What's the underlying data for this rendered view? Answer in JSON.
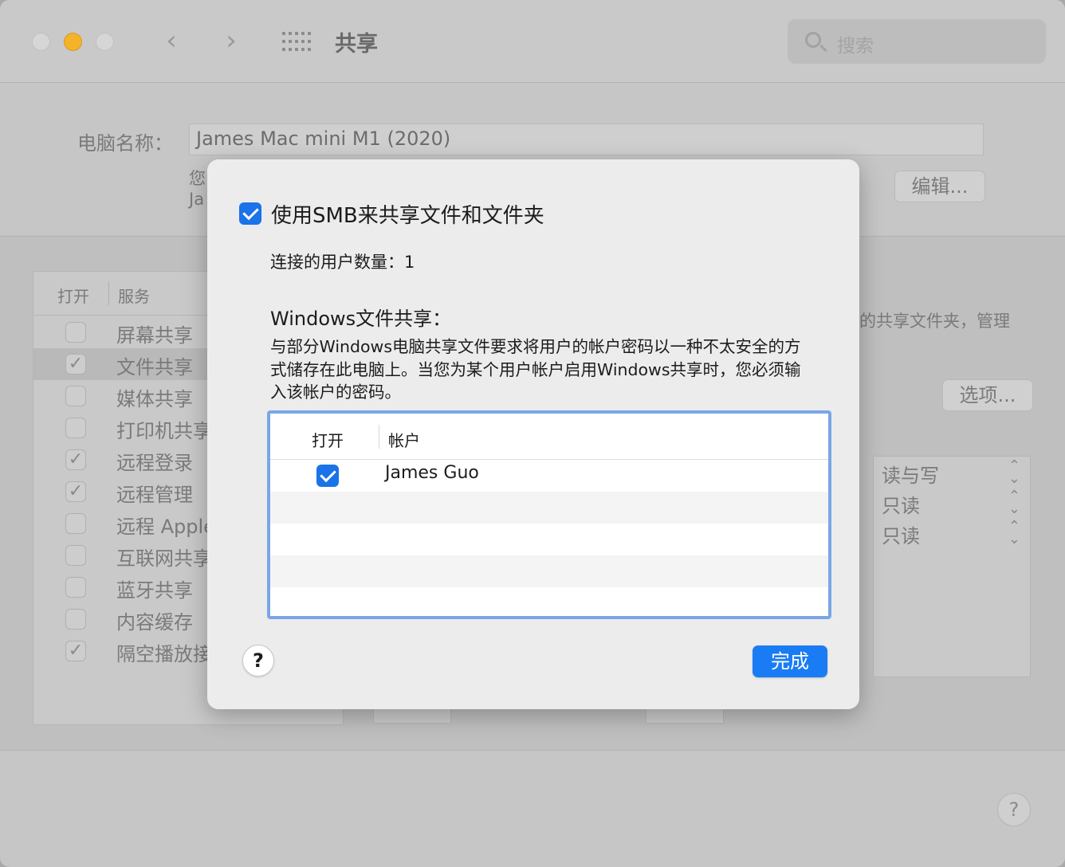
{
  "window": {
    "title": "共享"
  },
  "search": {
    "placeholder": "搜索"
  },
  "computer_name": {
    "label": "电脑名称：",
    "value": "James Mac mini M1 (2020)",
    "partial_line1": "您",
    "partial_line2": "Ja",
    "edit_label": "编辑..."
  },
  "services": {
    "col_on": "打开",
    "col_service": "服务",
    "items": [
      {
        "label": "屏幕共享",
        "checked": false
      },
      {
        "label": "文件共享",
        "checked": true
      },
      {
        "label": "媒体共享",
        "checked": false
      },
      {
        "label": "打印机共享",
        "checked": false
      },
      {
        "label": "远程登录",
        "checked": true
      },
      {
        "label": "远程管理",
        "checked": true
      },
      {
        "label": "远程 Apple",
        "checked": false
      },
      {
        "label": "互联网共享",
        "checked": false
      },
      {
        "label": "蓝牙共享",
        "checked": false
      },
      {
        "label": "内容缓存",
        "checked": false
      },
      {
        "label": "隔空播放接",
        "checked": true
      }
    ]
  },
  "right_partial_text": "的共享文件夹，管理",
  "options_label": "选项...",
  "permissions": [
    "读与写",
    "只读",
    "只读"
  ],
  "sheet": {
    "smb_label": "使用SMB来共享文件和文件夹",
    "users_count": "连接的用户数量：1",
    "windows_title": "Windows文件共享：",
    "windows_desc": "与部分Windows电脑共享文件要求将用户的帐户密码以一种不太安全的方式储存在此电脑上。当您为某个用户帐户启用Windows共享时，您必须输入该帐户的密码。",
    "table": {
      "col_on": "打开",
      "col_account": "帐户",
      "rows": [
        {
          "name": "James Guo",
          "checked": true
        }
      ]
    },
    "help_label": "?",
    "done_label": "完成"
  },
  "help_label": "?",
  "colors": {
    "accent": "#1a7cf5",
    "checkbox": "#1a73e8",
    "table_focus": "#7aa6e8"
  }
}
